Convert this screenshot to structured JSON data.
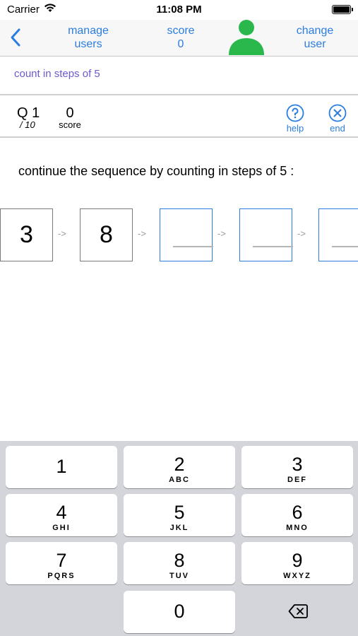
{
  "status": {
    "carrier": "Carrier",
    "time": "11:08 PM",
    "wifi_icon": "wifi-icon",
    "battery_icon": "battery-icon"
  },
  "nav": {
    "manage_users": "manage\nusers",
    "score_label": "score",
    "score_value": "0",
    "change_user": "change\nuser",
    "avatar_color": "#2ab84d",
    "accent": "#2b7de0"
  },
  "topic": "count in steps of 5",
  "info": {
    "question": "Q 1",
    "total": "/ 10",
    "score_value": "0",
    "score_label": "score",
    "help_label": "help",
    "end_label": "end"
  },
  "question": {
    "prompt": "continue the sequence by counting in steps of 5 :",
    "sequence": [
      "3",
      "8",
      "",
      "",
      ""
    ],
    "arrow": "->"
  },
  "keyboard": {
    "keys": [
      {
        "digit": "1",
        "letters": ""
      },
      {
        "digit": "2",
        "letters": "ABC"
      },
      {
        "digit": "3",
        "letters": "DEF"
      },
      {
        "digit": "4",
        "letters": "GHI"
      },
      {
        "digit": "5",
        "letters": "JKL"
      },
      {
        "digit": "6",
        "letters": "MNO"
      },
      {
        "digit": "7",
        "letters": "PQRS"
      },
      {
        "digit": "8",
        "letters": "TUV"
      },
      {
        "digit": "9",
        "letters": "WXYZ"
      },
      {
        "digit": "0",
        "letters": ""
      }
    ],
    "delete_icon": "backspace-icon"
  }
}
